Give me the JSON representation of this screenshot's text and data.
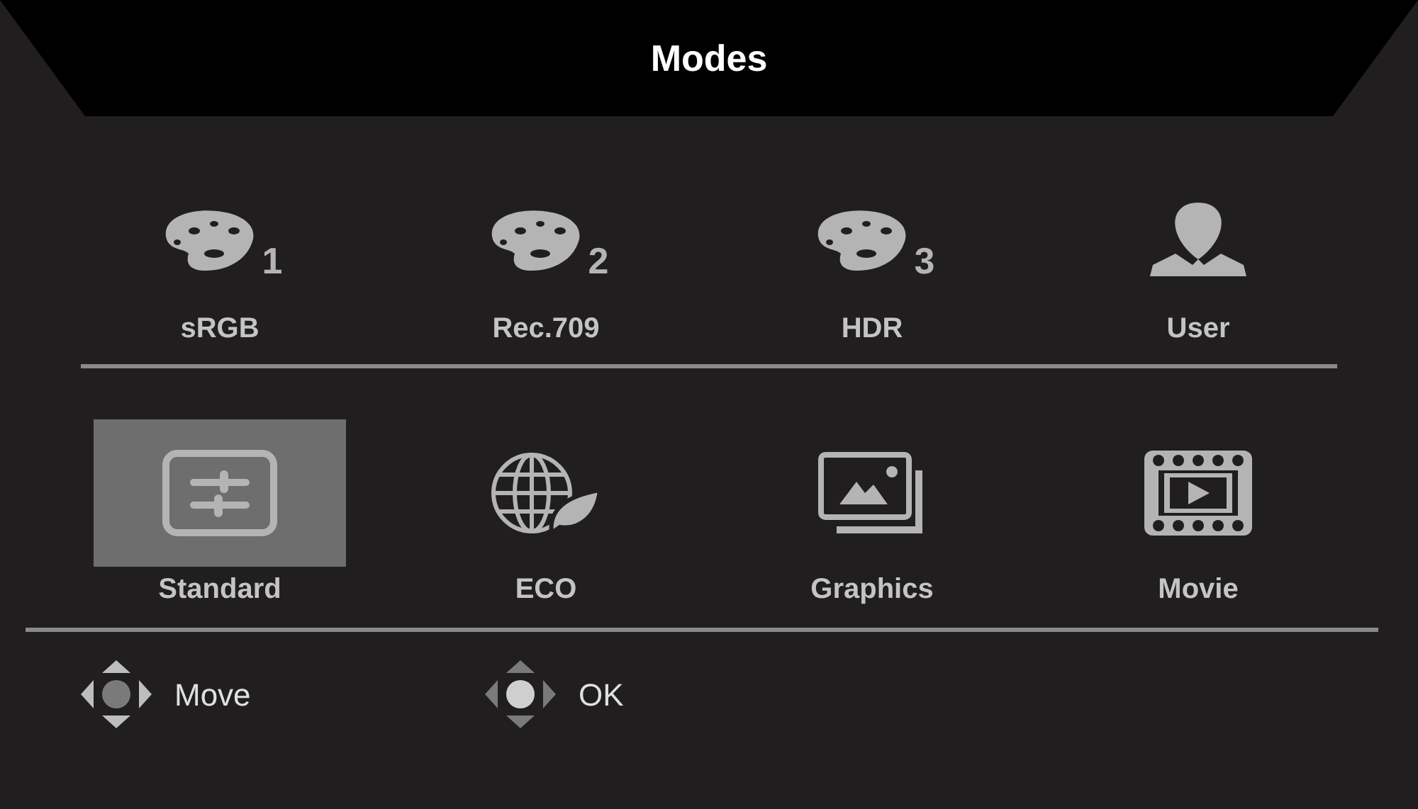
{
  "title": "Modes",
  "preset_modes": [
    {
      "kind": "palette",
      "number": "1",
      "label": "sRGB",
      "selected": false
    },
    {
      "kind": "palette",
      "number": "2",
      "label": "Rec.709",
      "selected": false
    },
    {
      "kind": "palette",
      "number": "3",
      "label": "HDR",
      "selected": false
    },
    {
      "kind": "user",
      "label": "User",
      "selected": false
    }
  ],
  "scene_modes": [
    {
      "kind": "standard",
      "label": "Standard",
      "selected": true
    },
    {
      "kind": "eco",
      "label": "ECO",
      "selected": false
    },
    {
      "kind": "graphics",
      "label": "Graphics",
      "selected": false
    },
    {
      "kind": "movie",
      "label": "Movie",
      "selected": false
    }
  ],
  "hints": [
    {
      "kind": "move",
      "label": "Move"
    },
    {
      "kind": "ok",
      "label": "OK"
    }
  ]
}
